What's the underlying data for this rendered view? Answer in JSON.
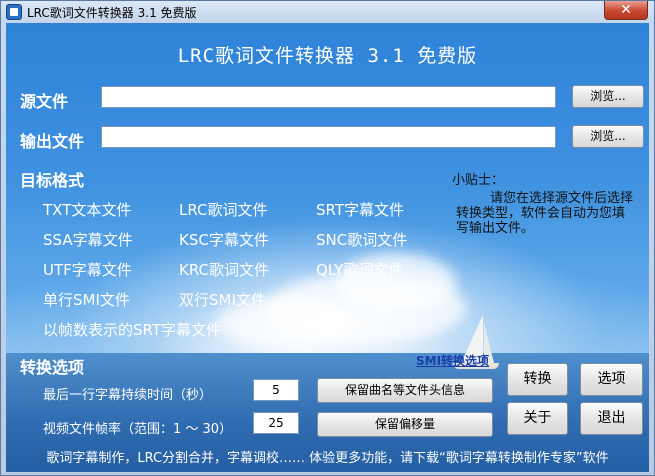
{
  "window": {
    "title": "LRC歌词文件转换器 3.1 免费版",
    "close_label": "✕"
  },
  "header": {
    "title": "LRC歌词文件转换器 3.1 免费版"
  },
  "source": {
    "label": "源文件",
    "value": "",
    "browse_label": "浏览..."
  },
  "output": {
    "label": "输出文件",
    "value": "",
    "browse_label": "浏览..."
  },
  "target_format": {
    "label": "目标格式",
    "items": [
      "TXT文本文件",
      "LRC歌词文件",
      "SRT字幕文件",
      "SSA字幕文件",
      "KSC字幕文件",
      "SNC歌词文件",
      "UTF字幕文件",
      "KRC歌词文件",
      "QLY歌词文件",
      "单行SMI文件",
      "双行SMI文件",
      "以帧数表示的SRT字幕文件"
    ]
  },
  "tip": {
    "title": "小贴士：",
    "text": "请您在选择源文件后选择转换类型，软件会自动为您填写输出文件。"
  },
  "options": {
    "label": "转换选项",
    "smi_link": "SMI转换选项",
    "last_line_label": "最后一行字幕持续时间（秒）",
    "last_line_value": "5",
    "framerate_label": "视频文件帧率（范围：1 ～ 30）",
    "framerate_value": "25",
    "keep_header_label": "保留曲名等文件头信息",
    "keep_offset_label": "保留偏移量"
  },
  "actions": {
    "convert": "转换",
    "options": "选项",
    "about": "关于",
    "exit": "退出"
  },
  "footer": {
    "text": "歌词字幕制作，LRC分割合并，字幕调校…… 体验更多功能，请下载“歌词字幕转换制作专家”软件"
  },
  "colors": {
    "sky_top": "#2e82d8",
    "link": "#1a3fa8",
    "close_button": "#c8472f"
  }
}
